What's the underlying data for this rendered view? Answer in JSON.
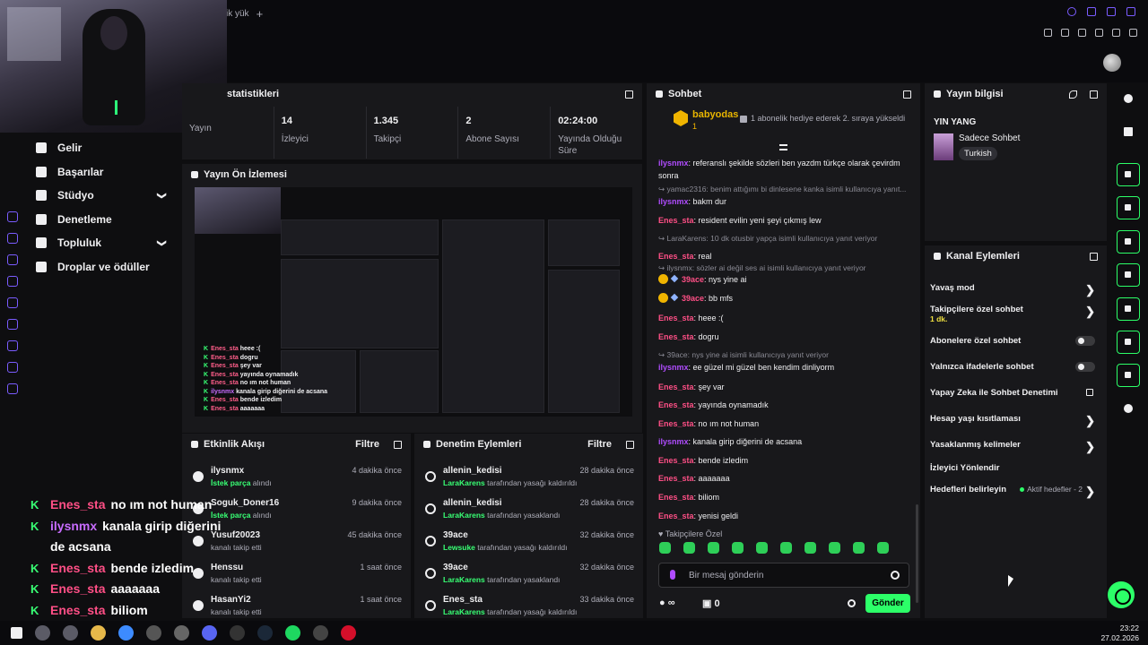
{
  "topbar": {
    "tab_label": "ik yük",
    "tab_add": "+"
  },
  "nav": {
    "items": [
      {
        "label": "Gelir",
        "icon": "revenue-icon"
      },
      {
        "label": "Başarılar",
        "icon": "trophy-icon"
      },
      {
        "label": "Stüdyo",
        "icon": "studio-icon",
        "expand": "❯"
      },
      {
        "label": "Denetleme",
        "icon": "hammer-icon"
      },
      {
        "label": "Topluluk",
        "icon": "community-icon",
        "expand": "❯"
      },
      {
        "label": "Droplar ve ödüller",
        "icon": "gift-icon"
      }
    ]
  },
  "stats": {
    "title": "statistikleri",
    "items": [
      {
        "value": "",
        "label": "Yayın"
      },
      {
        "value": "14",
        "label": "İzleyici"
      },
      {
        "value": "1.345",
        "label": "Takipçi"
      },
      {
        "value": "2",
        "label": "Abone Sayısı"
      },
      {
        "value": "02:24:00",
        "label": "Yayında Olduğu Süre"
      }
    ]
  },
  "preview": {
    "title": "Yayın Ön İzlemesi",
    "chat": [
      {
        "user": "Enes_sta",
        "text": "heee :("
      },
      {
        "user": "Enes_sta",
        "text": "dogru"
      },
      {
        "user": "Enes_sta",
        "text": "şey var"
      },
      {
        "user": "Enes_sta",
        "text": "yayında oynamadık"
      },
      {
        "user": "Enes_sta",
        "text": "no ım not human"
      },
      {
        "user": "ilysnmx",
        "text": "kanala girip diğerini de acsana"
      },
      {
        "user": "Enes_sta",
        "text": "bende izledim"
      },
      {
        "user": "Enes_sta",
        "text": "aaaaaaa"
      }
    ]
  },
  "feed": {
    "title": "Etkinlik Akışı",
    "filter": "Filtre",
    "rows": [
      {
        "name": "ilysnmx",
        "time": "4 dakika önce",
        "hl": "İstek parça",
        "sub": " alındı",
        "icon": "channel-points-icon"
      },
      {
        "name": "Soguk_Doner16",
        "time": "9 dakika önce",
        "hl": "İstek parça",
        "sub": " alındı",
        "icon": "channel-points-icon"
      },
      {
        "name": "Yusuf20023",
        "time": "45 dakika önce",
        "hl": "",
        "sub": "kanalı takip etti",
        "icon": "heart-icon"
      },
      {
        "name": "Henssu",
        "time": "1 saat önce",
        "hl": "",
        "sub": "kanalı takip etti",
        "icon": "heart-icon"
      },
      {
        "name": "HasanYi2",
        "time": "1 saat önce",
        "hl": "",
        "sub": "kanalı takip etti",
        "icon": "heart-icon"
      }
    ]
  },
  "moderation": {
    "title": "Denetim Eylemleri",
    "filter": "Filtre",
    "rows": [
      {
        "name": "allenin_kedisi",
        "time": "28 dakika önce",
        "hl": "LaraKarens",
        "sub": " tarafından yasağı kaldırıldı",
        "icon": "undo-icon"
      },
      {
        "name": "allenin_kedisi",
        "time": "28 dakika önce",
        "hl": "LaraKarens",
        "sub": " tarafından yasaklandı",
        "icon": "ban-icon"
      },
      {
        "name": "39ace",
        "time": "32 dakika önce",
        "hl": "Lewsuke",
        "sub": " tarafından yasağı kaldırıldı",
        "icon": "undo-icon"
      },
      {
        "name": "39ace",
        "time": "32 dakika önce",
        "hl": "LaraKarens",
        "sub": " tarafından yasaklandı",
        "icon": "ban-icon"
      },
      {
        "name": "Enes_sta",
        "time": "33 dakika önce",
        "hl": "LaraKarens",
        "sub": " tarafından yasağı kaldırıldı",
        "icon": "undo-icon"
      }
    ]
  },
  "chat": {
    "title": "Sohbet",
    "pinned": {
      "user": "babyodas",
      "count": "1",
      "text": "1 abonelik hediye ederek 2. sıraya yükseldi"
    },
    "messages": [
      {
        "type": "msg",
        "user": "ilysnmx",
        "color": "#b04cff",
        "text": ": referanslı şekilde sözleri ben yazdm türkçe olarak çevirdm sonra"
      },
      {
        "type": "reply",
        "text": "yamac2316: benim attığımı bi dinlesene kanka isimli kullanıcıya yanıt..."
      },
      {
        "type": "msg",
        "user": "ilysnmx",
        "color": "#b04cff",
        "text": ": bakm dur"
      },
      {
        "type": "msg",
        "user": "Enes_sta",
        "color": "#ff4f86",
        "text": ": resident evilin yeni şeyi çıkmış lew"
      },
      {
        "type": "reply",
        "text": "LaraKarens: 10 dk otusbir yapça isimli kullanıcıya yanıt veriyor"
      },
      {
        "type": "msg",
        "user": "Enes_sta",
        "color": "#ff4f86",
        "text": ": real"
      },
      {
        "type": "reply",
        "text": "ilysnmx: sözler ai değil ses ai isimli kullanıcıya yanıt veriyor"
      },
      {
        "type": "badge",
        "user": "39ace",
        "color": "#ff4f86",
        "text": ": nys yine ai"
      },
      {
        "type": "badge",
        "user": "39ace",
        "color": "#ff4f86",
        "text": ": bb mfs"
      },
      {
        "type": "msg",
        "user": "Enes_sta",
        "color": "#ff4f86",
        "text": ": heee :("
      },
      {
        "type": "msg",
        "user": "Enes_sta",
        "color": "#ff4f86",
        "text": ": dogru"
      },
      {
        "type": "reply",
        "text": "39ace: nys yine ai isimli kullanıcıya yanıt veriyor"
      },
      {
        "type": "msg",
        "user": "ilysnmx",
        "color": "#b04cff",
        "text": ": ee güzel mi güzel ben kendim dinliyorm"
      },
      {
        "type": "msg",
        "user": "Enes_sta",
        "color": "#ff4f86",
        "text": ": şey var"
      },
      {
        "type": "msg",
        "user": "Enes_sta",
        "color": "#ff4f86",
        "text": ": yayında oynamadık"
      },
      {
        "type": "msg",
        "user": "Enes_sta",
        "color": "#ff4f86",
        "text": ": no ım not human"
      },
      {
        "type": "msg",
        "user": "ilysnmx",
        "color": "#b04cff",
        "text": ": kanala girip diğerini de acsana"
      },
      {
        "type": "msg",
        "user": "Enes_sta",
        "color": "#ff4f86",
        "text": ": bende izledim"
      },
      {
        "type": "msg",
        "user": "Enes_sta",
        "color": "#ff4f86",
        "text": ": aaaaaaa"
      },
      {
        "type": "msg",
        "user": "Enes_sta",
        "color": "#ff4f86",
        "text": ": biliom"
      },
      {
        "type": "msg",
        "user": "Enes_sta",
        "color": "#ff4f86",
        "text": ": yenisi geldi"
      }
    ],
    "followers_only": "Takipçilere Özel",
    "placeholder": "Bir mesaj gönderin",
    "points": "∞",
    "bits": "0",
    "send": "Gönder"
  },
  "stream_info": {
    "title": "Yayın bilgisi",
    "stream_title": "YIN YANG",
    "category": "Sadece Sohbet",
    "tag": "Turkish"
  },
  "channel_actions": {
    "title": "Kanal Eylemleri",
    "items": [
      {
        "label": "Yavaş mod",
        "kind": "chevron",
        "sub": ""
      },
      {
        "label": "Takipçilere özel sohbet",
        "kind": "chevron",
        "sub": "1 dk."
      },
      {
        "label": "Abonelere özel sohbet",
        "kind": "toggle",
        "sub": ""
      },
      {
        "label": "Yalnızca ifadelerle sohbet",
        "kind": "toggle",
        "sub": ""
      },
      {
        "label": "Yapay Zeka ile Sohbet Denetimi",
        "kind": "external",
        "sub": ""
      },
      {
        "label": "Hesap yaşı kısıtlaması",
        "kind": "chevron",
        "sub": ""
      },
      {
        "label": "Yasaklanmış kelimeler",
        "kind": "chevron",
        "sub": ""
      },
      {
        "label": "İzleyici Yönlendir",
        "kind": "none",
        "sub": ""
      },
      {
        "label": "Hedefleri belirleyin",
        "kind": "goal",
        "sub": "Aktif hedefler - 2"
      }
    ],
    "chevron": "❯"
  },
  "overlay_chat": [
    {
      "user": "Enes_sta",
      "text": "no ım not human",
      "purple": false
    },
    {
      "user": "ilysnmx",
      "text": "kanala girip diğerini de acsana",
      "purple": true
    },
    {
      "user": "Enes_sta",
      "text": "bende izledim",
      "purple": false
    },
    {
      "user": "Enes_sta",
      "text": "aaaaaaa",
      "purple": false
    },
    {
      "user": "Enes_sta",
      "text": "biliom",
      "purple": false
    },
    {
      "user": "Enes_sta",
      "text": "yenisi geldi",
      "purple": false
    }
  ],
  "taskbar": {
    "time": "23:22",
    "date": "27.02.2026",
    "apps": [
      "windows-icon",
      "search-icon",
      "task-view-icon",
      "explorer-icon",
      "browser-icon",
      "unity-icon",
      "app-icon",
      "discord-icon",
      "epic-games-icon",
      "steam-icon",
      "spotify-icon",
      "obs-icon",
      "opera-icon"
    ]
  },
  "colors": {
    "accent": "#2cff68",
    "panel": "#18181b",
    "background": "#0e0e10",
    "username_pink": "#ff4f86",
    "username_purple": "#b04cff"
  }
}
